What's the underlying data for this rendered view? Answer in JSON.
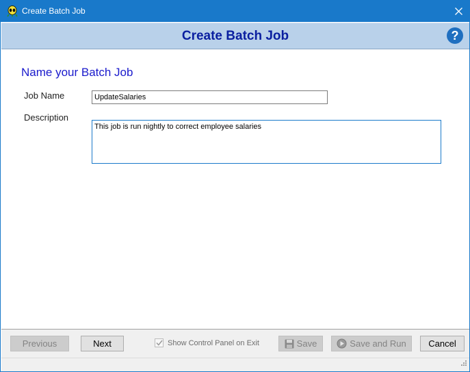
{
  "window": {
    "title": "Create Batch Job",
    "accent": "#1979ca"
  },
  "header": {
    "title": "Create Batch Job",
    "help_label": "?",
    "title_color": "#0a1fa0"
  },
  "form": {
    "heading": "Name your Batch Job",
    "job_name_label": "Job Name",
    "job_name_value": "UpdateSalaries",
    "description_label": "Description",
    "description_value": "This job is run nightly to correct employee salaries"
  },
  "footer": {
    "previous_label": "Previous",
    "next_label": "Next",
    "show_control_panel_label": "Show Control Panel on Exit",
    "show_control_panel_checked": true,
    "save_label": "Save",
    "save_and_run_label": "Save and Run",
    "cancel_label": "Cancel"
  },
  "icons": {
    "app": "alien-app-icon",
    "close": "close-icon",
    "help": "help-icon",
    "save": "floppy-disk-icon",
    "run": "play-circle-icon",
    "grip": "resize-grip-icon"
  }
}
